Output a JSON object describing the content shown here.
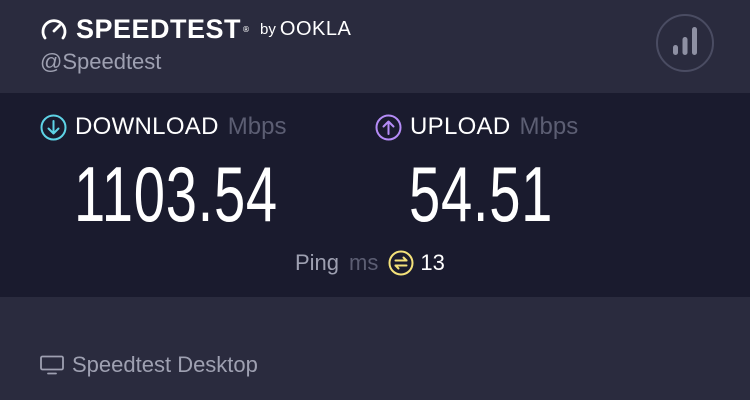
{
  "header": {
    "brand": "SPEEDTEST",
    "trademark": "®",
    "by": "by",
    "partner": "OOKLA",
    "handle": "@Speedtest",
    "results_icon": "bar-chart-icon"
  },
  "download": {
    "label": "DOWNLOAD",
    "unit": "Mbps",
    "value": "1103.54",
    "icon": "arrow-down-circle-icon",
    "accent": "#5ed3e6"
  },
  "upload": {
    "label": "UPLOAD",
    "unit": "Mbps",
    "value": "54.51",
    "icon": "arrow-up-circle-icon",
    "accent": "#b58cf7"
  },
  "ping": {
    "label": "Ping",
    "unit": "ms",
    "value": "13",
    "icon": "ping-icon",
    "accent": "#f4e27a"
  },
  "footer": {
    "label": "Speedtest Desktop",
    "icon": "desktop-icon"
  },
  "colors": {
    "background": "#2a2b3e",
    "panel": "#1a1b2e",
    "muted_text": "#9ea0b1",
    "unit_text": "#5c5e73"
  }
}
